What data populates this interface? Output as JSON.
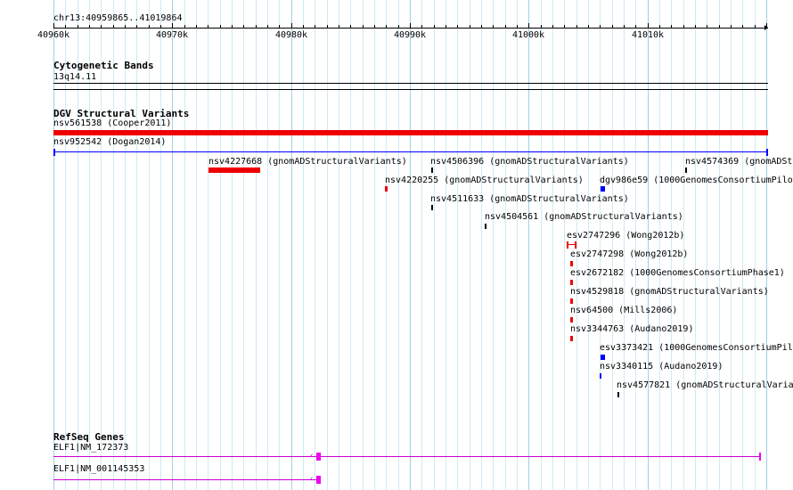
{
  "position_label": "chr13:40959865..41019864",
  "ruler": {
    "ticks": [
      {
        "label": "40960k",
        "bp": 40960000
      },
      {
        "label": "40970k",
        "bp": 40970000
      },
      {
        "label": "40980k",
        "bp": 40980000
      },
      {
        "label": "40990k",
        "bp": 40990000
      },
      {
        "label": "41000k",
        "bp": 41000000
      },
      {
        "label": "41010k",
        "bp": 41010000
      }
    ]
  },
  "tracks": {
    "cytoband": {
      "title": "Cytogenetic Bands",
      "band_label": "13q14.11"
    },
    "dgv": {
      "title": "DGV Structural Variants",
      "features": [
        {
          "id": "nsv561538",
          "source": "(Cooper2011)",
          "color": "#ee0000"
        },
        {
          "id": "nsv952542",
          "source": "(Dogan2014)",
          "color": "#0000ff"
        },
        {
          "id": "nsv4227668",
          "source": "(gnomADStructuralVariants)",
          "color": "#ee0000"
        },
        {
          "id": "nsv4506396",
          "source": "(gnomADStructuralVariants)",
          "color": "#000000"
        },
        {
          "id": "nsv4574369",
          "source": "(gnomADStr",
          "color": "#000000"
        },
        {
          "id": "nsv4220255",
          "source": "(gnomADStructuralVariants)",
          "color": "#ee0000"
        },
        {
          "id": "dgv986e59",
          "source": "(1000GenomesConsortiumPilo",
          "color": "#0000ff"
        },
        {
          "id": "nsv4511633",
          "source": "(gnomADStructuralVariants)",
          "color": "#000000"
        },
        {
          "id": "nsv4504561",
          "source": "(gnomADStructuralVariants)",
          "color": "#000000"
        },
        {
          "id": "esv2747296",
          "source": "(Wong2012b)",
          "color": "#ee0000"
        },
        {
          "id": "esv2747298",
          "source": "(Wong2012b)",
          "color": "#ee0000"
        },
        {
          "id": "esv2672182",
          "source": "(1000GenomesConsortiumPhase1)",
          "color": "#ee0000"
        },
        {
          "id": "nsv4529818",
          "source": "(gnomADStructuralVariants)",
          "color": "#ee0000"
        },
        {
          "id": "nsv64500",
          "source": "(Mills2006)",
          "color": "#ee0000"
        },
        {
          "id": "nsv3344763",
          "source": "(Audano2019)",
          "color": "#ee0000"
        },
        {
          "id": "esv3373421",
          "source": "(1000GenomesConsortiumPilo",
          "color": "#0000ff"
        },
        {
          "id": "nsv3340115",
          "source": "(Audano2019)",
          "color": "#0000ff"
        },
        {
          "id": "nsv4577821",
          "source": "(gnomADStructuralVaria",
          "color": "#000000"
        }
      ]
    },
    "refseq": {
      "title": "RefSeq Genes",
      "genes": [
        {
          "label": "ELF1|NM_172373",
          "color": "#cc00cc"
        },
        {
          "label": "ELF1|NM_001145353",
          "color": "#cc00cc"
        }
      ]
    }
  }
}
